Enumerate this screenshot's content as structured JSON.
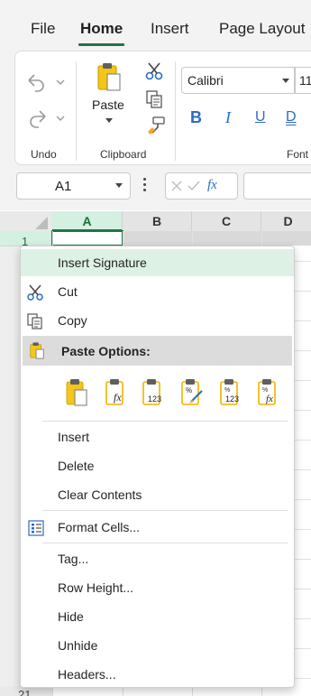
{
  "tabs": {
    "file": "File",
    "home": "Home",
    "insert": "Insert",
    "page_layout": "Page Layout"
  },
  "ribbon": {
    "undo_group": "Undo",
    "clipboard_group": "Clipboard",
    "font_group": "Font",
    "paste_label": "Paste",
    "font_name": "Calibri",
    "font_size": "11",
    "bold": "B",
    "italic": "I",
    "underline": "U",
    "double_underline": "D"
  },
  "formula_bar": {
    "name_box": "A1",
    "fx": "fx",
    "formula_value": ""
  },
  "grid": {
    "columns": [
      "A",
      "B",
      "C",
      "D"
    ],
    "first_row": "1",
    "last_row": "21"
  },
  "context_menu": {
    "insert_signature": "Insert Signature",
    "cut": "Cut",
    "copy": "Copy",
    "paste_options": "Paste Options:",
    "paste_option_icons": [
      "paste-icon",
      "paste-formulas-icon",
      "paste-values-icon",
      "paste-formatting-icon",
      "paste-values-number-format-icon",
      "paste-formulas-number-format-icon"
    ],
    "paste_option_labels": [
      "fx",
      "123",
      "%",
      "123",
      "fx"
    ],
    "insert": "Insert",
    "delete": "Delete",
    "clear_contents": "Clear Contents",
    "format_cells": "Format Cells...",
    "tag": "Tag...",
    "row_height": "Row Height...",
    "hide": "Hide",
    "unhide": "Unhide",
    "headers": "Headers..."
  },
  "colors": {
    "accent": "#217346",
    "selection_fill": "#d3f0e0",
    "highlight": "#ddf1e4",
    "ribbon_icon_blue": "#2b6cc4",
    "clipboard_yellow": "#f5c518"
  }
}
